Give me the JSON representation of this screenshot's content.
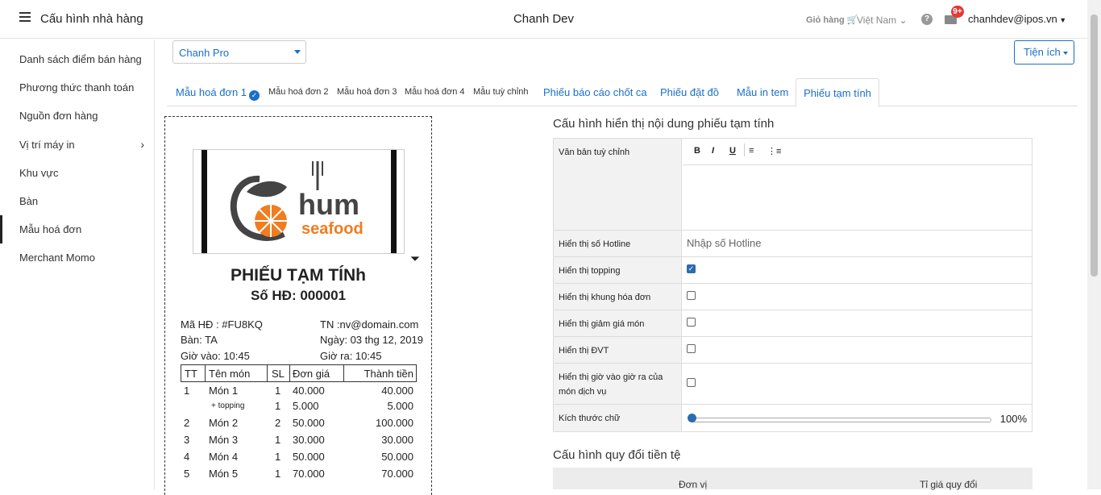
{
  "topbar": {
    "title": "Cấu hình nhà hàng",
    "brand": "Chanh Dev",
    "cart_label": "Giỏ hàng",
    "language": "Việt Nam",
    "notification_count": "9+",
    "user_email": "chanhdev@ipos.vn"
  },
  "sidebar": {
    "items": [
      {
        "label": "Danh sách điểm bán hàng"
      },
      {
        "label": "Phương thức thanh toán"
      },
      {
        "label": "Nguồn đơn hàng"
      },
      {
        "label": "Vị trí máy in"
      },
      {
        "label": "Khu vực"
      },
      {
        "label": "Bàn"
      },
      {
        "label": "Mẫu hoá đơn"
      },
      {
        "label": "Merchant Momo"
      }
    ]
  },
  "store_select": {
    "value": "Chanh Pro"
  },
  "utilities_button": {
    "label": "Tiện ích"
  },
  "tabs": [
    {
      "label": "Mẫu hoá đơn 1"
    },
    {
      "label": "Mẫu hoá đơn 2"
    },
    {
      "label": "Mẫu hoá đơn 3"
    },
    {
      "label": "Mẫu hoá đơn 4"
    },
    {
      "label": "Mẫu tuỳ chỉnh"
    },
    {
      "label": "Phiếu báo cáo chốt ca"
    },
    {
      "label": "Phiếu đặt đồ"
    },
    {
      "label": "Mẫu in tem"
    },
    {
      "label": "Phiếu tạm tính"
    }
  ],
  "receipt": {
    "logo_text_1": "hum",
    "logo_text_2": "seafood",
    "title": "PHIẾU TẠM TÍNh",
    "number": "Số HĐ: 000001",
    "info": {
      "ma_hd": "Mã HĐ : #FU8KQ",
      "tn": "TN :nv@domain.com",
      "ban": "Bàn: TA",
      "ngay": "Ngày: 03 thg 12, 2019",
      "gio_vao": "Giờ vào: 10:45",
      "gio_ra": "Giờ ra: 10:45"
    },
    "columns": {
      "tt": "TT",
      "ten_mon": "Tên món",
      "sl": "SL",
      "don_gia": "Đơn giá",
      "thanh_tien": "Thành tiền"
    },
    "rows": [
      {
        "tt": "1",
        "name": "Món 1",
        "sl": "1",
        "price": "40.000",
        "total": "40.000"
      },
      {
        "tt": "",
        "name": "+ topping",
        "sl": "1",
        "price": "5.000",
        "total": "5.000"
      },
      {
        "tt": "2",
        "name": "Món 2",
        "sl": "2",
        "price": "50.000",
        "total": "100.000"
      },
      {
        "tt": "3",
        "name": "Món 3",
        "sl": "1",
        "price": "30.000",
        "total": "30.000"
      },
      {
        "tt": "4",
        "name": "Món 4",
        "sl": "1",
        "price": "50.000",
        "total": "50.000"
      },
      {
        "tt": "5",
        "name": "Món 5",
        "sl": "1",
        "price": "70.000",
        "total": "70.000"
      }
    ]
  },
  "config": {
    "title": "Cấu hình hiển thị nội dung phiếu tạm tính",
    "custom_text_label": "Văn bản tuỳ chỉnh",
    "toolbar": {
      "bold": "B",
      "italic": "I",
      "underline": "U"
    },
    "hotline_label": "Hiển thị số Hotline",
    "hotline_placeholder": "Nhập số Hotline",
    "options": [
      {
        "label": "Hiển thị topping",
        "checked": true
      },
      {
        "label": "Hiển thị khung hóa đơn",
        "checked": false
      },
      {
        "label": "Hiển thị giảm giá món",
        "checked": false
      },
      {
        "label": "Hiển thị ĐVT",
        "checked": false
      },
      {
        "label": "Hiển thị giờ vào giờ ra của món dịch vụ",
        "checked": false
      }
    ],
    "font_size_label": "Kích thước chữ",
    "font_size_value": "100%"
  },
  "currency": {
    "title": "Cấu hình quy đổi tiền tệ",
    "col_unit": "Đơn vị",
    "col_rate": "Tỉ giá quy đổi"
  }
}
